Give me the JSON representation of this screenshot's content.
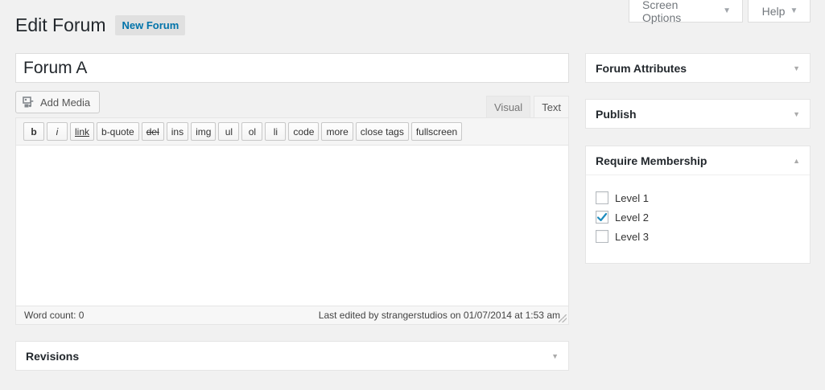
{
  "screen_meta": {
    "screen_options_label": "Screen Options",
    "help_label": "Help"
  },
  "page": {
    "title": "Edit Forum",
    "add_new_label": "New Forum"
  },
  "post": {
    "title_value": "Forum A"
  },
  "editor": {
    "add_media_label": "Add Media",
    "tabs": {
      "visual": "Visual",
      "text": "Text"
    },
    "active_tab": "Text",
    "quicktags": [
      "b",
      "i",
      "link",
      "b-quote",
      "del",
      "ins",
      "img",
      "ul",
      "ol",
      "li",
      "code",
      "more",
      "close tags",
      "fullscreen"
    ],
    "word_count": "Word count: 0",
    "last_edited": "Last edited by strangerstudios on 01/07/2014 at 1:53 am"
  },
  "boxes": {
    "revisions": "Revisions",
    "forum_attributes": "Forum Attributes",
    "publish": "Publish",
    "membership": {
      "title": "Require Membership",
      "levels": [
        {
          "label": "Level 1",
          "checked": false
        },
        {
          "label": "Level 2",
          "checked": true
        },
        {
          "label": "Level 3",
          "checked": false
        }
      ]
    }
  },
  "colors": {
    "accent": "#0073aa",
    "background": "#f1f1f1",
    "checkmark": "#1e8cbe"
  },
  "icons": {
    "toggle_collapsed": "triangle-down-icon",
    "toggle_expanded": "triangle-up-icon",
    "media": "media-icon",
    "checkmark": "checkmark-icon"
  }
}
